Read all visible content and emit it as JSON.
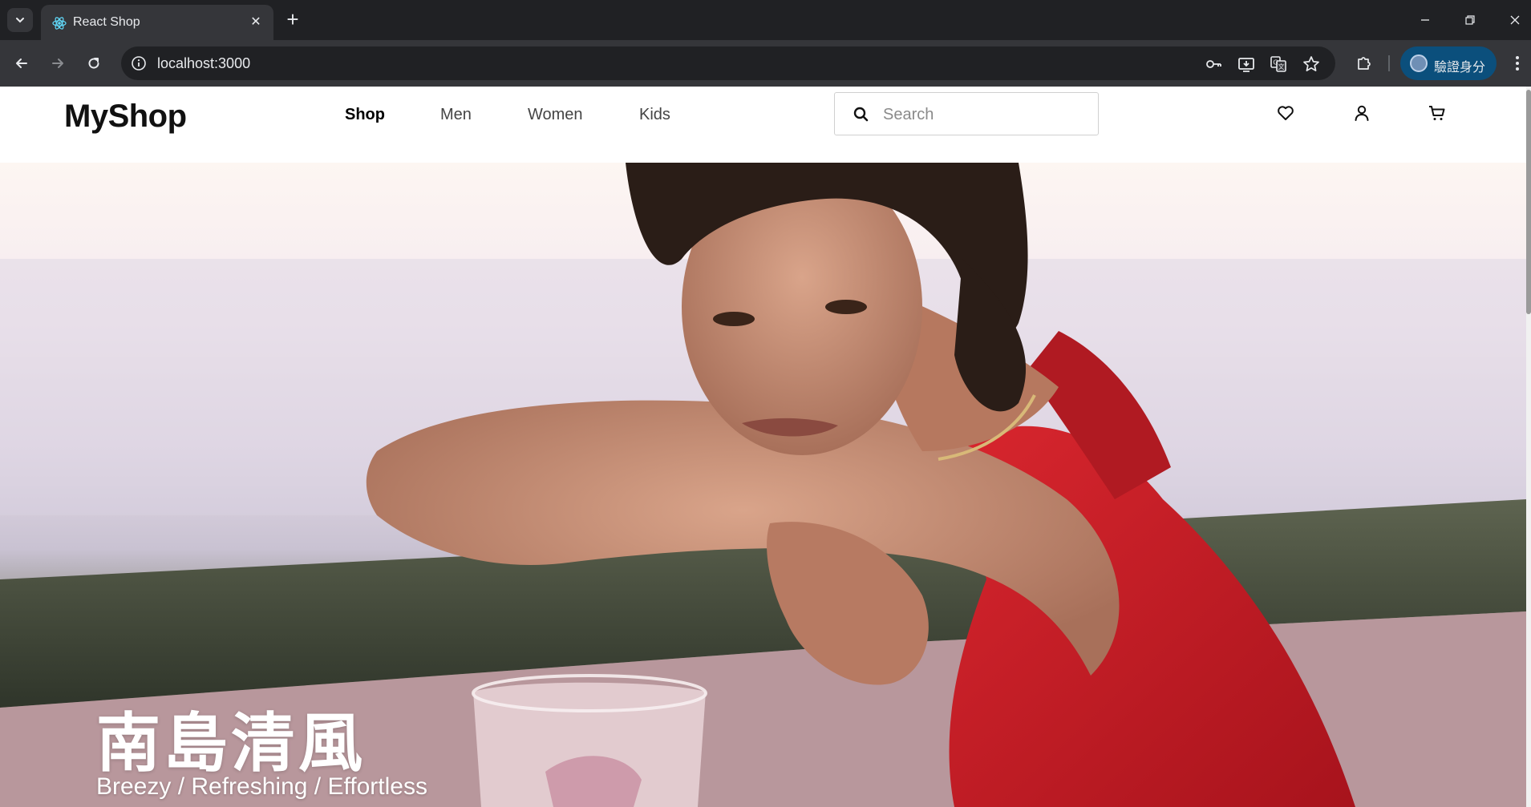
{
  "browser": {
    "tab_title": "React Shop",
    "url": "localhost:3000",
    "profile_label": "驗證身分"
  },
  "site": {
    "logo": "MyShop",
    "nav": [
      {
        "label": "Shop",
        "active": true
      },
      {
        "label": "Men",
        "active": false
      },
      {
        "label": "Women",
        "active": false
      },
      {
        "label": "Kids",
        "active": false
      }
    ],
    "search": {
      "placeholder": "Search",
      "value": ""
    },
    "icons": [
      "heart-icon",
      "user-icon",
      "cart-icon"
    ]
  },
  "hero": {
    "title": "南島清風",
    "subtitle": "Breezy / Refreshing / Effortless"
  }
}
